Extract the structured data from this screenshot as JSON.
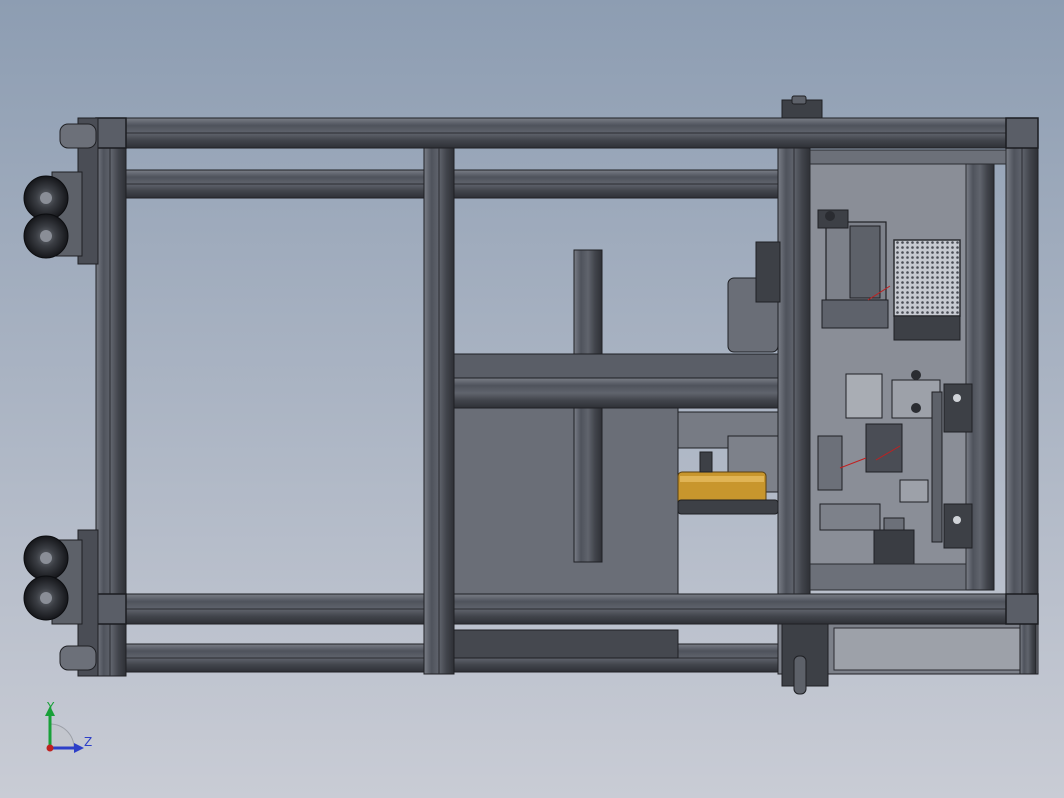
{
  "viewport": {
    "background_top": "#8d9db2",
    "background_bottom": "#c9ccd5"
  },
  "colors": {
    "frame": "#4f535c",
    "frame_light": "#6c7079",
    "frame_dark": "#2e3036",
    "panel": "#5e626b",
    "panel_dark": "#43464d",
    "accent_brass": "#c8962d",
    "axis_y": "#18a038",
    "axis_z": "#2d3fc8",
    "axis_origin": "#c02020"
  },
  "triad": {
    "y_label": "Y",
    "z_label": "Z",
    "icon": "coordinate-triad-icon"
  }
}
